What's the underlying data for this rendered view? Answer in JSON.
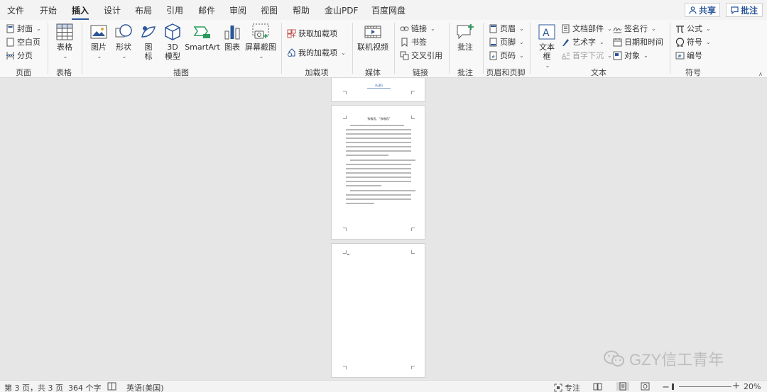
{
  "tabs": [
    {
      "label": "文件"
    },
    {
      "label": "开始"
    },
    {
      "label": "插入",
      "active": true
    },
    {
      "label": "设计"
    },
    {
      "label": "布局"
    },
    {
      "label": "引用"
    },
    {
      "label": "邮件"
    },
    {
      "label": "审阅"
    },
    {
      "label": "视图"
    },
    {
      "label": "帮助"
    },
    {
      "label": "金山PDF"
    },
    {
      "label": "百度网盘"
    }
  ],
  "share_label": "共享",
  "comment_top_label": "批注",
  "ribbon": {
    "pages": {
      "cover": "封面",
      "blank": "空白页",
      "break": "分页",
      "group": "页面"
    },
    "tables": {
      "table": "表格",
      "group": "表格"
    },
    "illustrations": {
      "picture": "图片",
      "shapes": "形状",
      "icons": "图\n标",
      "model3d": "3D\n模型",
      "smartart": "SmartArt",
      "chart": "图表",
      "screenshot": "屏幕截图",
      "group": "插图"
    },
    "addins": {
      "get": "获取加载项",
      "mine": "我的加载项",
      "group": "加载项"
    },
    "media": {
      "video": "联机视频",
      "group": "媒体"
    },
    "links": {
      "link": "链接",
      "bookmark": "书签",
      "crossref": "交叉引用",
      "group": "链接"
    },
    "comments": {
      "comment": "批注",
      "group": "批注"
    },
    "headerfooter": {
      "header": "页眉",
      "footer": "页脚",
      "pagenum": "页码",
      "group": "页眉和页脚"
    },
    "text": {
      "textbox": "文本框",
      "quickparts": "文档部件",
      "wordart": "艺术字",
      "dropcap": "首字下沉",
      "signature": "签名行",
      "datetime": "日期和时间",
      "object": "对象",
      "group": "文本"
    },
    "symbols": {
      "equation": "公式",
      "symbol": "符号",
      "number": "编号",
      "group": "符号"
    }
  },
  "document": {
    "page1_footer_text": "(标题)",
    "page2_title": "致敬我、“致敬我”"
  },
  "status": {
    "page": "第 3 页，共 3 页",
    "words": "364 个字",
    "language": "英语(美国)",
    "focus": "专注",
    "zoom": "20%"
  },
  "watermark": "GZY信工青年"
}
